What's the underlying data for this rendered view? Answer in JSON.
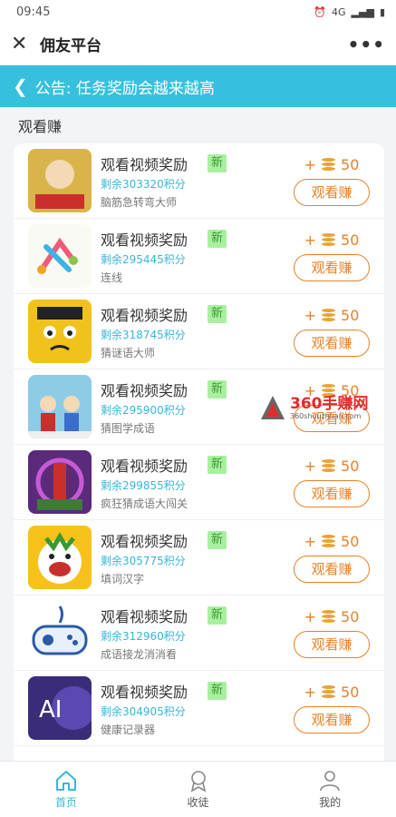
{
  "status_bar": {
    "time": "09:45",
    "icons": [
      "alarm-icon",
      "wifi-icon",
      "4g-icon",
      "signal-icon",
      "battery-icon"
    ],
    "network": "4G"
  },
  "nav": {
    "title": "佣友平台",
    "close_icon": "close-icon",
    "more_icon": "more-icon"
  },
  "announcement": {
    "text": "公告: 任务奖励会越来越高",
    "icon": "back-chevron-icon"
  },
  "section": {
    "title": "观看赚"
  },
  "tasks": [
    {
      "title": "观看视频奖励",
      "badge": "新",
      "remaining": "剩余303320积分",
      "game": "脑筋急转弯大师",
      "reward_prefix": "+",
      "reward": "50",
      "button": "观看赚",
      "thumb_color": "#d9b44a"
    },
    {
      "title": "观看视频奖励",
      "badge": "新",
      "remaining": "剩余295445积分",
      "game": "连线",
      "reward_prefix": "+",
      "reward": "50",
      "button": "观看赚",
      "thumb_color": "#fafaf5"
    },
    {
      "title": "观看视频奖励",
      "badge": "新",
      "remaining": "剩余318745积分",
      "game": "猜谜语大师",
      "reward_prefix": "+",
      "reward": "50",
      "button": "观看赚",
      "thumb_color": "#f2c21c"
    },
    {
      "title": "观看视频奖励",
      "badge": "新",
      "remaining": "剩余295900积分",
      "game": "猜图学成语",
      "reward_prefix": "+",
      "reward": "50",
      "button": "观看赚",
      "thumb_color": "#8ecbe6"
    },
    {
      "title": "观看视频奖励",
      "badge": "新",
      "remaining": "剩余299855积分",
      "game": "疯狂猜成语大闯关",
      "reward_prefix": "+",
      "reward": "50",
      "button": "观看赚",
      "thumb_color": "#5a2b7a"
    },
    {
      "title": "观看视频奖励",
      "badge": "新",
      "remaining": "剩余305775积分",
      "game": "填词汉字",
      "reward_prefix": "+",
      "reward": "50",
      "button": "观看赚",
      "thumb_color": "#f6c21a"
    },
    {
      "title": "观看视频奖励",
      "badge": "新",
      "remaining": "剩余312960积分",
      "game": "成语接龙消消看",
      "reward_prefix": "+",
      "reward": "50",
      "button": "观看赚",
      "thumb_color": "#ffffff"
    },
    {
      "title": "观看视频奖励",
      "badge": "新",
      "remaining": "剩余304905积分",
      "game": "健康记录器",
      "reward_prefix": "+",
      "reward": "50",
      "button": "观看赚",
      "thumb_color": "#3b2c7a"
    }
  ],
  "watermark": {
    "main": "360手赚网",
    "sub": "360shouzhuan.com"
  },
  "tabbar": {
    "home": "首页",
    "collect": "收徒",
    "mine": "我的"
  },
  "colors": {
    "accent": "#37c0dd",
    "reward": "#e5812a",
    "badge_bg": "#a8f0a0",
    "badge_text": "#3a9a2f"
  }
}
